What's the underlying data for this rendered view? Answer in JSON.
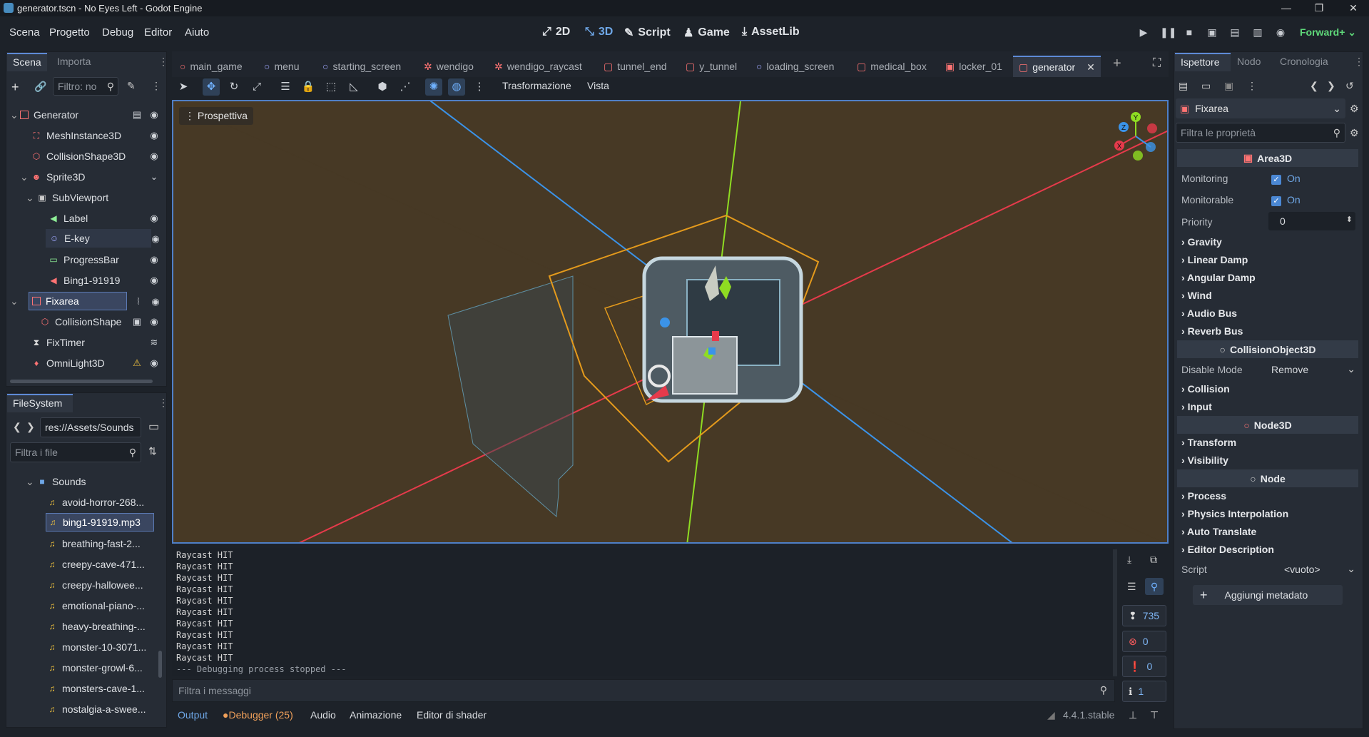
{
  "window": {
    "title": "generator.tscn - No Eyes Left - Godot Engine"
  },
  "menu": {
    "items": [
      "Scena",
      "Progetto",
      "Debug",
      "Editor",
      "Aiuto"
    ]
  },
  "main_buttons": {
    "b2d": "2D",
    "b3d": "3D",
    "script": "Script",
    "game": "Game",
    "assetlib": "AssetLib"
  },
  "renderer": "Forward+",
  "scene_dock": {
    "tabs": [
      "Scena",
      "Importa"
    ],
    "filter_placeholder": "Filtro: no",
    "nodes": [
      {
        "label": "Generator",
        "icon": "area-icon"
      },
      {
        "label": "MeshInstance3D",
        "icon": "mesh-icon"
      },
      {
        "label": "CollisionShape3D",
        "icon": "collision-icon"
      },
      {
        "label": "Sprite3D",
        "icon": "sprite-icon"
      },
      {
        "label": "SubViewport",
        "icon": "viewport-icon"
      },
      {
        "label": "Label",
        "icon": "label-icon"
      },
      {
        "label": "E-key",
        "icon": "texture-icon"
      },
      {
        "label": "ProgressBar",
        "icon": "progress-icon"
      },
      {
        "label": "Bing1-91919",
        "icon": "audio-icon"
      },
      {
        "label": "Fixarea",
        "icon": "area-icon"
      },
      {
        "label": "CollisionShape",
        "icon": "collision-icon"
      },
      {
        "label": "FixTimer",
        "icon": "timer-icon"
      },
      {
        "label": "OmniLight3D",
        "icon": "light-icon"
      }
    ]
  },
  "filesystem": {
    "tab": "FileSystem",
    "path": "res://Assets/Sounds",
    "filter_placeholder": "Filtra i file",
    "folder": "Sounds",
    "files": [
      "avoid-horror-268...",
      "bing1-91919.mp3",
      "breathing-fast-2...",
      "creepy-cave-471...",
      "creepy-hallowee...",
      "emotional-piano-...",
      "heavy-breathing-...",
      "monster-10-3071...",
      "monster-growl-6...",
      "monsters-cave-1...",
      "nostalgia-a-swee..."
    ]
  },
  "scene_tabs": [
    "main_game",
    "menu",
    "starting_screen",
    "wendigo",
    "wendigo_raycast",
    "tunnel_end",
    "y_tunnel",
    "loading_screen",
    "medical_box",
    "locker_01",
    "generator"
  ],
  "viewport_toolbar": {
    "transform": "Trasformazione",
    "view": "Vista"
  },
  "viewport": {
    "perspective_label": "Prospettiva",
    "gizmo": {
      "x": "X",
      "y": "Y",
      "z": "Z"
    }
  },
  "output": {
    "lines": [
      "Raycast HIT",
      "Raycast HIT",
      "Raycast HIT",
      "Raycast HIT",
      "Raycast HIT",
      "Raycast HIT",
      "Raycast HIT",
      "Raycast HIT",
      "Raycast HIT",
      "Raycast HIT",
      "--- Debugging process stopped ---"
    ],
    "filter_placeholder": "Filtra i messaggi",
    "counts": {
      "messages": "735",
      "errors": "0",
      "warnings": "0",
      "info": "1"
    }
  },
  "bottom_tabs": {
    "output": "Output",
    "debugger": "Debugger (25)",
    "audio": "Audio",
    "animation": "Animazione",
    "shader": "Editor di shader",
    "version": "4.4.1.stable"
  },
  "inspector": {
    "tabs": [
      "Ispettore",
      "Nodo",
      "Cronologia"
    ],
    "node_name": "Fixarea",
    "filter_placeholder": "Filtra le proprietà",
    "area3d": "Area3D",
    "monitoring_label": "Monitoring",
    "monitoring_value": "On",
    "monitorable_label": "Monitorable",
    "monitorable_value": "On",
    "priority_label": "Priority",
    "priority_value": "0",
    "area_sections": [
      "Gravity",
      "Linear Damp",
      "Angular Damp",
      "Wind",
      "Audio Bus",
      "Reverb Bus"
    ],
    "collision_object": "CollisionObject3D",
    "disable_mode_label": "Disable Mode",
    "disable_mode_value": "Remove",
    "collision_sections": [
      "Collision",
      "Input"
    ],
    "node3d": "Node3D",
    "node3d_sections": [
      "Transform",
      "Visibility"
    ],
    "node": "Node",
    "node_sections": [
      "Process",
      "Physics Interpolation",
      "Auto Translate",
      "Editor Description"
    ],
    "script_label": "Script",
    "script_value": "<vuoto>",
    "add_metadata": "Aggiungi metadato"
  }
}
